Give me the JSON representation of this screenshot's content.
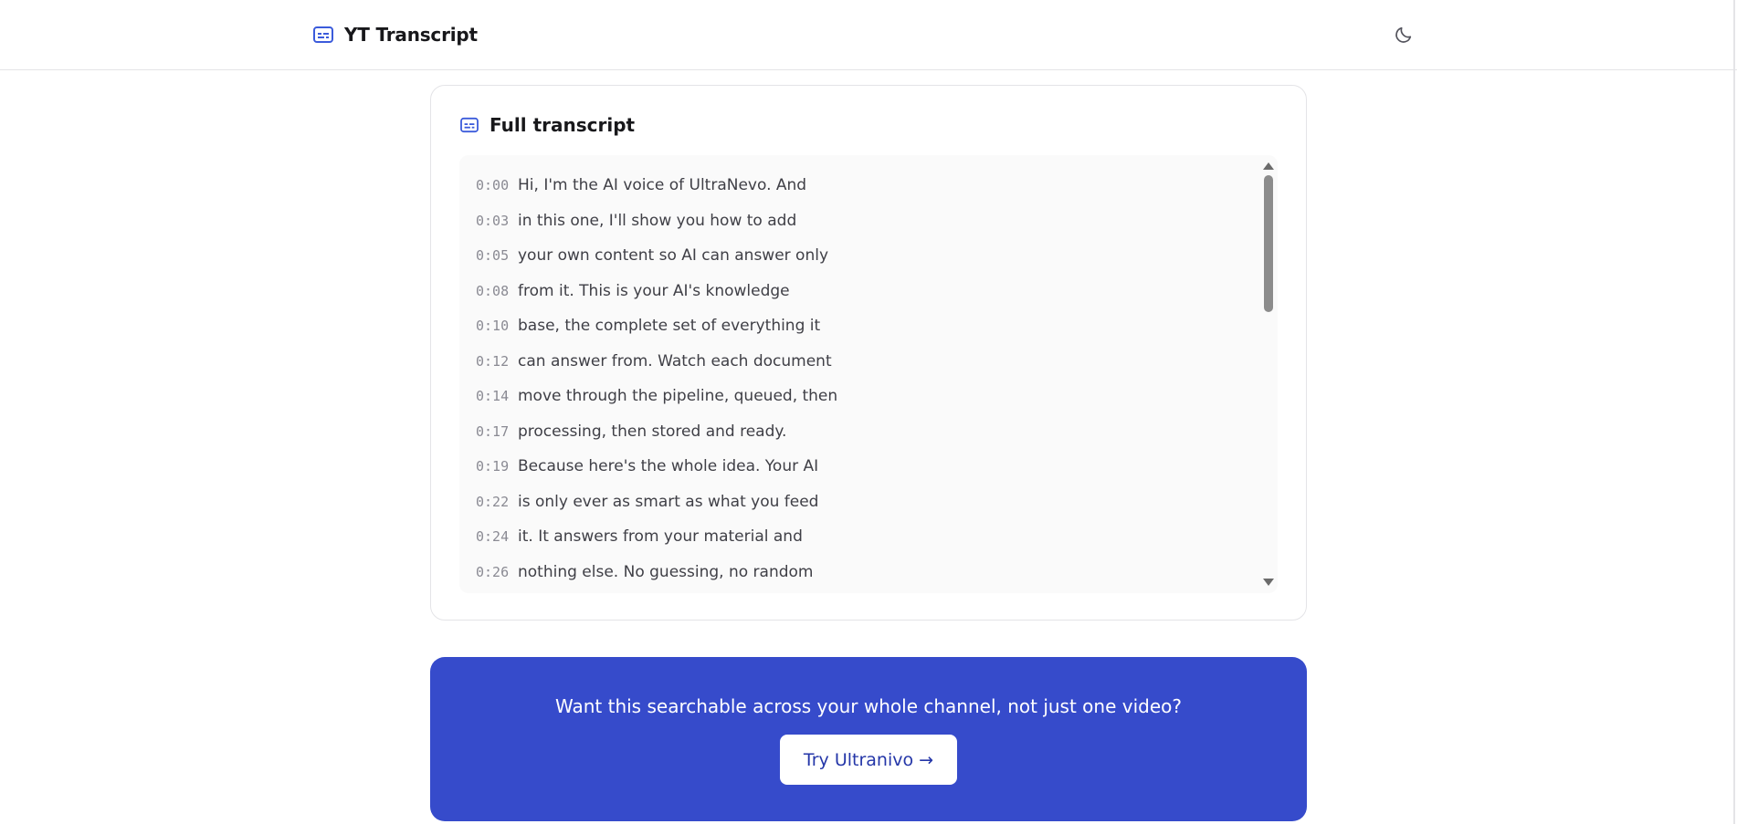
{
  "header": {
    "app_title": "YT Transcript",
    "app_icon": "caption-icon",
    "theme_icon": "moon-icon"
  },
  "transcript": {
    "title": "Full transcript",
    "icon": "caption-icon",
    "lines": [
      {
        "time": "0:00",
        "text": "Hi, I'm the AI voice of UltraNevo. And"
      },
      {
        "time": "0:03",
        "text": "in this one, I'll show you how to add"
      },
      {
        "time": "0:05",
        "text": "your own content so AI can answer only"
      },
      {
        "time": "0:08",
        "text": "from it. This is your AI's knowledge"
      },
      {
        "time": "0:10",
        "text": "base, the complete set of everything it"
      },
      {
        "time": "0:12",
        "text": "can answer from. Watch each document"
      },
      {
        "time": "0:14",
        "text": "move through the pipeline, queued, then"
      },
      {
        "time": "0:17",
        "text": "processing, then stored and ready."
      },
      {
        "time": "0:19",
        "text": "Because here's the whole idea. Your AI"
      },
      {
        "time": "0:22",
        "text": "is only ever as smart as what you feed"
      },
      {
        "time": "0:24",
        "text": "it. It answers from your material and"
      },
      {
        "time": "0:26",
        "text": "nothing else. No guessing, no random"
      }
    ]
  },
  "cta": {
    "message": "Want this searchable across your whole channel, not just one video?",
    "button_label": "Try Ultranivo →"
  },
  "colors": {
    "accent": "#364bcb",
    "accent_text": "#2436a8",
    "icon_blue": "#3b5bdb"
  }
}
